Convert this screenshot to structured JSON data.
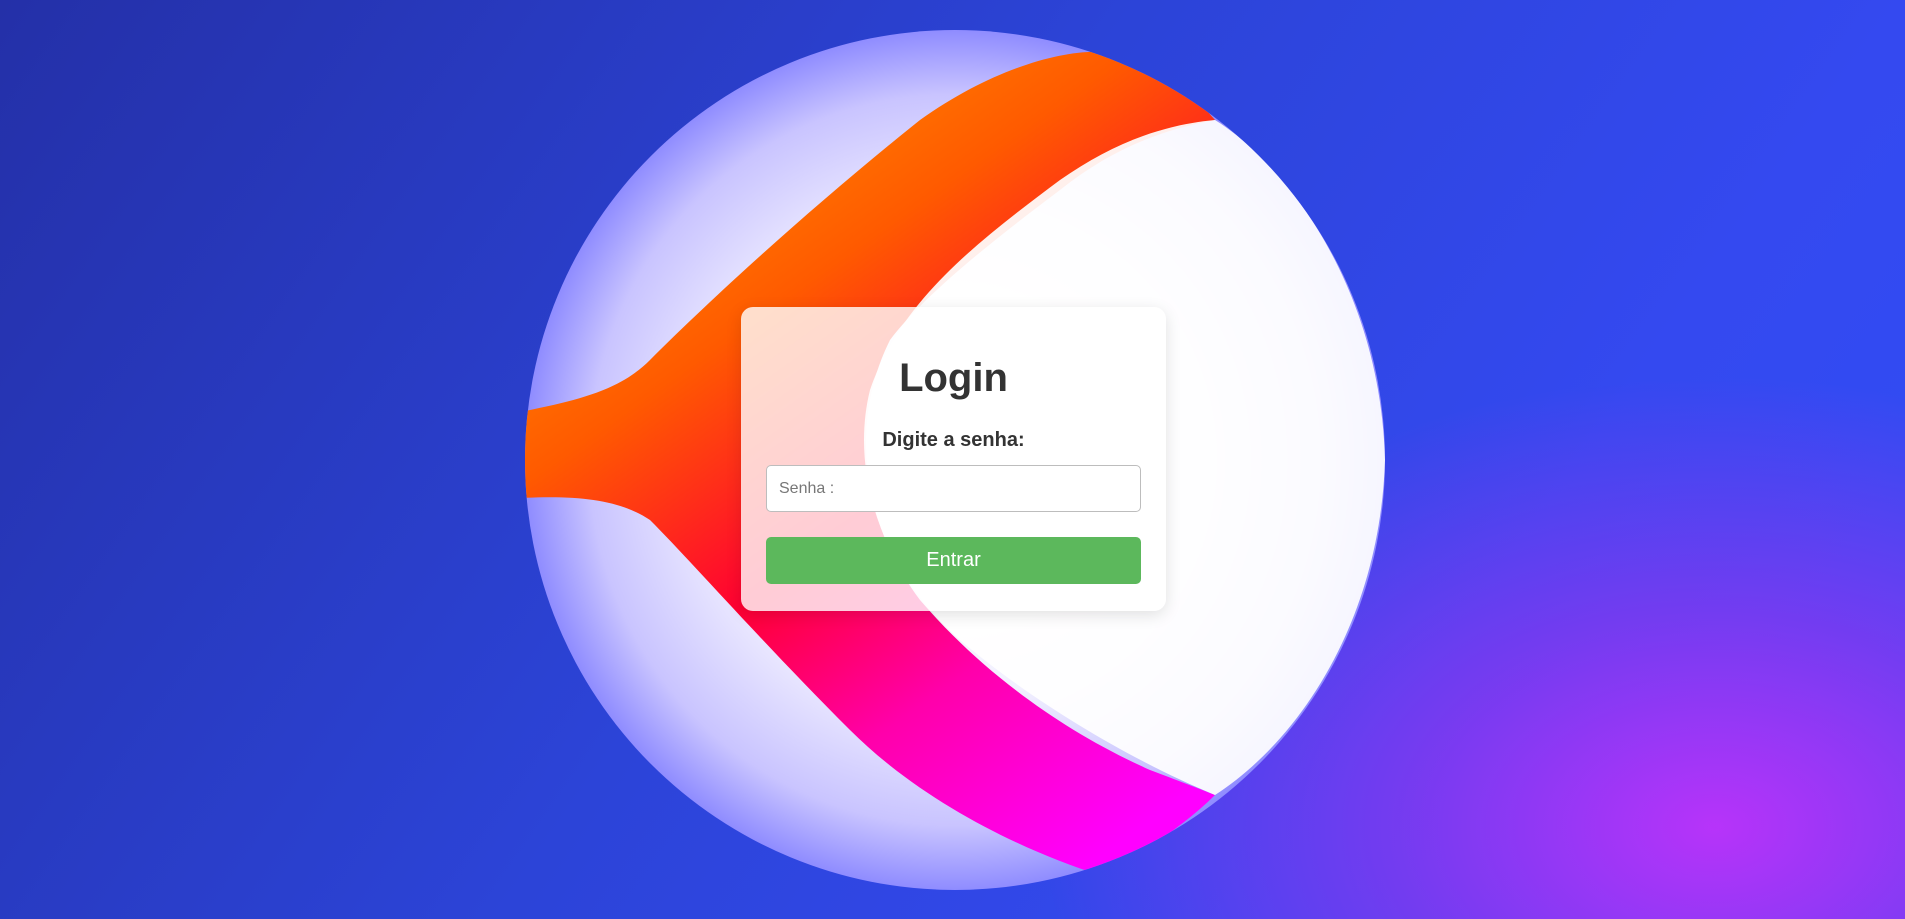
{
  "login": {
    "title": "Login",
    "prompt": "Digite a senha:",
    "password_placeholder": "Senha :",
    "password_value": "",
    "submit_label": "Entrar"
  },
  "colors": {
    "background_blue": "#2f4df5",
    "background_purple": "#b432f0",
    "accent_orange": "#ff9900",
    "accent_red": "#ff0000",
    "accent_magenta": "#ff00ff",
    "button_green": "#5cb85c",
    "text_dark": "#333333"
  }
}
